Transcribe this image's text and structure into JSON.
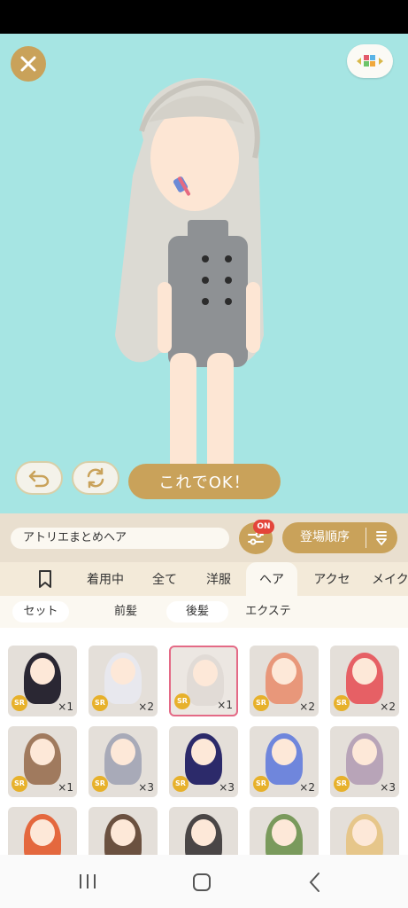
{
  "actions": {
    "ok_label": "これでOK！"
  },
  "outfit": {
    "name": "アトリエまとめヘア",
    "filter_badge": "ON",
    "sort_label": "登場順序"
  },
  "categories": [
    {
      "label": "着用中"
    },
    {
      "label": "全て"
    },
    {
      "label": "洋服"
    },
    {
      "label": "ヘア"
    },
    {
      "label": "アクセ"
    },
    {
      "label": "メイク"
    }
  ],
  "subcategories": [
    {
      "label": "セット"
    },
    {
      "label": "前髪"
    },
    {
      "label": "後髪"
    },
    {
      "label": "エクステ"
    }
  ],
  "items": [
    {
      "rarity": "SR",
      "qty": "×1",
      "hair_color": "#2a2733"
    },
    {
      "rarity": "SR",
      "qty": "×2",
      "hair_color": "#e8e8ee"
    },
    {
      "rarity": "SR",
      "qty": "×1",
      "hair_color": "#d8d2cc"
    },
    {
      "rarity": "SR",
      "qty": "×2",
      "hair_color": "#e8977a"
    },
    {
      "rarity": "SR",
      "qty": "×2",
      "hair_color": "#e66065"
    },
    {
      "rarity": "SR",
      "qty": "×1",
      "hair_color": "#a07a5e"
    },
    {
      "rarity": "SR",
      "qty": "×3",
      "hair_color": "#a8aab8"
    },
    {
      "rarity": "SR",
      "qty": "×3",
      "hair_color": "#2c2a6a"
    },
    {
      "rarity": "SR",
      "qty": "×2",
      "hair_color": "#6f86dc"
    },
    {
      "rarity": "SR",
      "qty": "×3",
      "hair_color": "#b8a4b8"
    },
    {
      "rarity": "",
      "qty": "",
      "hair_color": "#e4683e"
    },
    {
      "rarity": "",
      "qty": "",
      "hair_color": "#6b5140"
    },
    {
      "rarity": "",
      "qty": "",
      "hair_color": "#4a4646"
    },
    {
      "rarity": "",
      "qty": "",
      "hair_color": "#7a9a5c"
    },
    {
      "rarity": "",
      "qty": "",
      "hair_color": "#e6c68a"
    }
  ],
  "colors": {
    "accent": "#c9a25a",
    "stage_bg": "#a6e5e3",
    "selected_border": "#e46a86",
    "badge": "#e4453a"
  }
}
